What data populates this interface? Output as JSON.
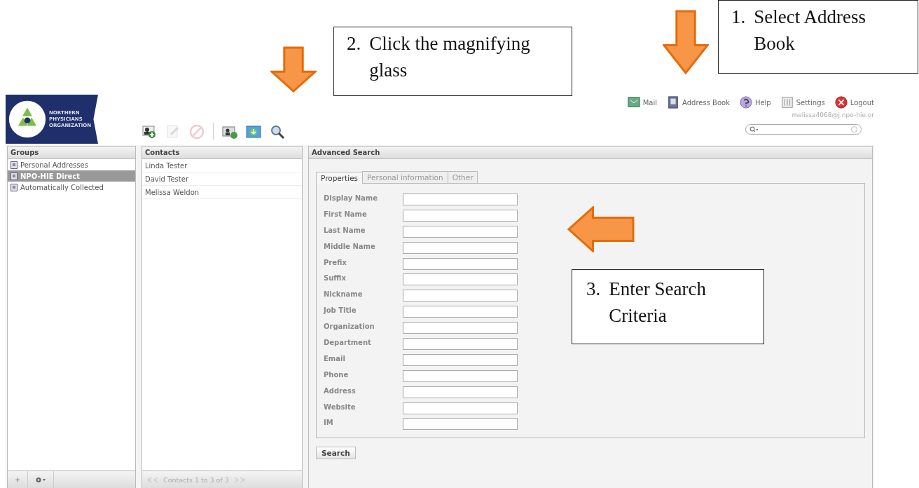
{
  "callouts": [
    {
      "number": "1.",
      "text": "Select Address Book"
    },
    {
      "number": "2.",
      "text": "Click the magnifying glass"
    },
    {
      "number": "3.",
      "text": "Enter Search Criteria"
    }
  ],
  "logo": {
    "lines": [
      "NORTHERN",
      "PHYSICIANS",
      "ORGANIZATION"
    ]
  },
  "toolbar": [
    {
      "kind": "add-contact",
      "disabled": false
    },
    {
      "kind": "edit",
      "disabled": true
    },
    {
      "kind": "delete",
      "disabled": true
    },
    {
      "kind": "import",
      "disabled": false
    },
    {
      "kind": "export",
      "disabled": false
    },
    {
      "kind": "search",
      "disabled": false
    }
  ],
  "nav": [
    {
      "kind": "mail",
      "label": "Mail"
    },
    {
      "kind": "addressbook",
      "label": "Address Book"
    },
    {
      "kind": "help",
      "label": "Help"
    },
    {
      "kind": "settings",
      "label": "Settings"
    },
    {
      "kind": "logout",
      "label": "Logout"
    }
  ],
  "user_email": "melissa4068@j.npo-hie.or",
  "groups": {
    "title": "Groups",
    "items": [
      {
        "label": "Personal Addresses",
        "selected": false
      },
      {
        "label": "NPO-HIE Direct",
        "selected": true
      },
      {
        "label": "Automatically Collected",
        "selected": false
      }
    ],
    "add_button": "+"
  },
  "contacts": {
    "title": "Contacts",
    "items": [
      {
        "label": "Linda Tester"
      },
      {
        "label": "David Tester"
      },
      {
        "label": "Melissa Weldon"
      }
    ],
    "pager": "Contacts 1 to 3 of 3"
  },
  "advanced_search": {
    "title": "Advanced Search",
    "tabs": [
      {
        "label": "Properties",
        "selected": true
      },
      {
        "label": "Personal information",
        "selected": false
      },
      {
        "label": "Other",
        "selected": false
      }
    ],
    "fields": [
      {
        "label": "Display Name"
      },
      {
        "label": "First Name"
      },
      {
        "label": "Last Name"
      },
      {
        "label": "Middle Name"
      },
      {
        "label": "Prefix"
      },
      {
        "label": "Suffix"
      },
      {
        "label": "Nickname"
      },
      {
        "label": "Job Title"
      },
      {
        "label": "Organization"
      },
      {
        "label": "Department"
      },
      {
        "label": "Email"
      },
      {
        "label": "Phone"
      },
      {
        "label": "Address"
      },
      {
        "label": "Website"
      },
      {
        "label": "IM"
      }
    ],
    "button": "Search"
  }
}
